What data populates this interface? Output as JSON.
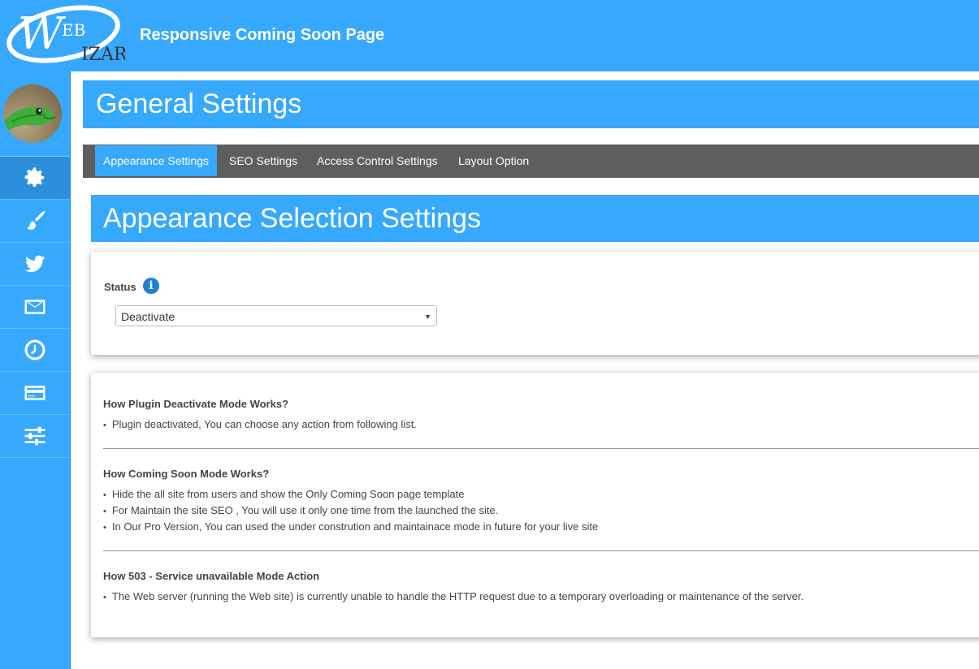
{
  "app": {
    "logo_text_top": "EB",
    "logo_text_bottom": "IZAR",
    "title": "Responsive Coming Soon Page"
  },
  "sidebar": {
    "items": [
      {
        "icon": "gear-icon"
      },
      {
        "icon": "brush-icon"
      },
      {
        "icon": "twitter-icon"
      },
      {
        "icon": "envelope-icon"
      },
      {
        "icon": "clock-icon"
      },
      {
        "icon": "credit-card-icon"
      },
      {
        "icon": "sliders-icon"
      }
    ]
  },
  "page": {
    "title": "General Settings"
  },
  "tabs": [
    {
      "label": "Appearance Settings",
      "active": true
    },
    {
      "label": "SEO Settings"
    },
    {
      "label": "Access Control Settings"
    },
    {
      "label": "Layout Option"
    }
  ],
  "appearance": {
    "title": "Appearance Selection Settings",
    "status_label": "Status",
    "info_glyph": "i",
    "status_value": "Deactivate",
    "caret": "▼"
  },
  "info": {
    "sections": [
      {
        "title": "How Plugin Deactivate Mode Works?",
        "bullets": [
          "Plugin deactivated, You can choose any action from following list."
        ]
      },
      {
        "title": "How Coming Soon Mode Works?",
        "bullets": [
          "Hide the all site from users and show the Only Coming Soon page template",
          "For Maintain the site SEO , You will use it only one time from the launched the site.",
          "In Our Pro Version, You can used the under constrution and maintainace mode in future for your live site"
        ]
      },
      {
        "title": "How 503 - Service unavailable Mode Action",
        "bullets": [
          "The Web server (running the Web site) is currently unable to handle the HTTP request due to a temporary overloading or maintenance of the server."
        ]
      }
    ]
  },
  "colors": {
    "primary": "#36a9fe",
    "tabbar": "#5e5e5e",
    "active_sidebar": "#2d8fdc"
  }
}
